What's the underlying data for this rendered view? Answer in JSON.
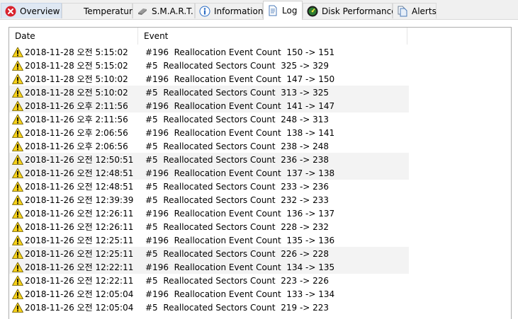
{
  "tabs": [
    {
      "label": "Overview",
      "icon": "error-icon"
    },
    {
      "label": "Temperature",
      "icon": ""
    },
    {
      "label": "S.M.A.R.T.",
      "icon": "smart-icon"
    },
    {
      "label": "Information",
      "icon": "info-icon"
    },
    {
      "label": "Log",
      "icon": "log-icon"
    },
    {
      "label": "Disk Performance",
      "icon": "performance-icon"
    },
    {
      "label": "Alerts",
      "icon": "alerts-icon"
    }
  ],
  "active_tab": "Log",
  "log": {
    "columns": [
      "Date",
      "Event"
    ],
    "rows": [
      {
        "date": "2018-11-28 오전 5:15:02",
        "event": "#196  Reallocation Event Count  150 -> 151"
      },
      {
        "date": "2018-11-28 오전 5:15:02",
        "event": "#5  Reallocated Sectors Count  325 -> 329"
      },
      {
        "date": "2018-11-28 오전 5:10:02",
        "event": "#196  Reallocation Event Count  147 -> 150"
      },
      {
        "date": "2018-11-28 오전 5:10:02",
        "event": "#5  Reallocated Sectors Count  313 -> 325"
      },
      {
        "date": "2018-11-26 오후 2:11:56",
        "event": "#196  Reallocation Event Count  141 -> 147"
      },
      {
        "date": "2018-11-26 오후 2:11:56",
        "event": "#5  Reallocated Sectors Count  248 -> 313"
      },
      {
        "date": "2018-11-26 오후 2:06:56",
        "event": "#196  Reallocation Event Count  138 -> 141"
      },
      {
        "date": "2018-11-26 오후 2:06:56",
        "event": "#5  Reallocated Sectors Count  238 -> 248"
      },
      {
        "date": "2018-11-26 오전 12:50:51",
        "event": "#5  Reallocated Sectors Count  236 -> 238"
      },
      {
        "date": "2018-11-26 오전 12:48:51",
        "event": "#196  Reallocation Event Count  137 -> 138"
      },
      {
        "date": "2018-11-26 오전 12:48:51",
        "event": "#5  Reallocated Sectors Count  233 -> 236"
      },
      {
        "date": "2018-11-26 오전 12:39:39",
        "event": "#5  Reallocated Sectors Count  232 -> 233"
      },
      {
        "date": "2018-11-26 오전 12:26:11",
        "event": "#196  Reallocation Event Count  136 -> 137"
      },
      {
        "date": "2018-11-26 오전 12:26:11",
        "event": "#5  Reallocated Sectors Count  228 -> 232"
      },
      {
        "date": "2018-11-26 오전 12:25:11",
        "event": "#196  Reallocation Event Count  135 -> 136"
      },
      {
        "date": "2018-11-26 오전 12:25:11",
        "event": "#5  Reallocated Sectors Count  226 -> 228"
      },
      {
        "date": "2018-11-26 오전 12:22:11",
        "event": "#196  Reallocation Event Count  134 -> 135"
      },
      {
        "date": "2018-11-26 오전 12:22:11",
        "event": "#5  Reallocated Sectors Count  223 -> 226"
      },
      {
        "date": "2018-11-26 오전 12:05:04",
        "event": "#196  Reallocation Event Count  133 -> 134"
      },
      {
        "date": "2018-11-26 오전 12:05:04",
        "event": "#5  Reallocated Sectors Count  219 -> 223"
      }
    ],
    "row_icon": "warning-icon",
    "alt_row_color": "#f3f3f3"
  },
  "colors": {
    "error_red": "#d9232e",
    "warning_yellow": "#f7d21a",
    "info_blue": "#2b6cc4"
  }
}
